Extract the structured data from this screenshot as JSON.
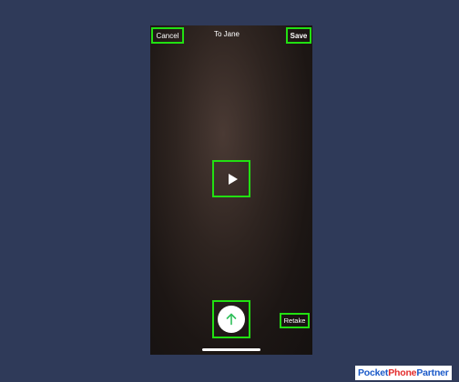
{
  "header": {
    "cancel_label": "Cancel",
    "title": "To Jane",
    "save_label": "Save"
  },
  "player": {
    "play_icon": "play-icon"
  },
  "footer": {
    "send_icon": "arrow-up-icon",
    "retake_label": "Retake"
  },
  "watermark": {
    "part1": "Pocket",
    "part2": "Phone",
    "part3": "Partner"
  },
  "colors": {
    "background": "#2f3a59",
    "highlight": "#22e012",
    "send_arrow": "#2fbf5a",
    "logo_blue": "#1a59c8",
    "logo_red": "#e32b2b"
  }
}
